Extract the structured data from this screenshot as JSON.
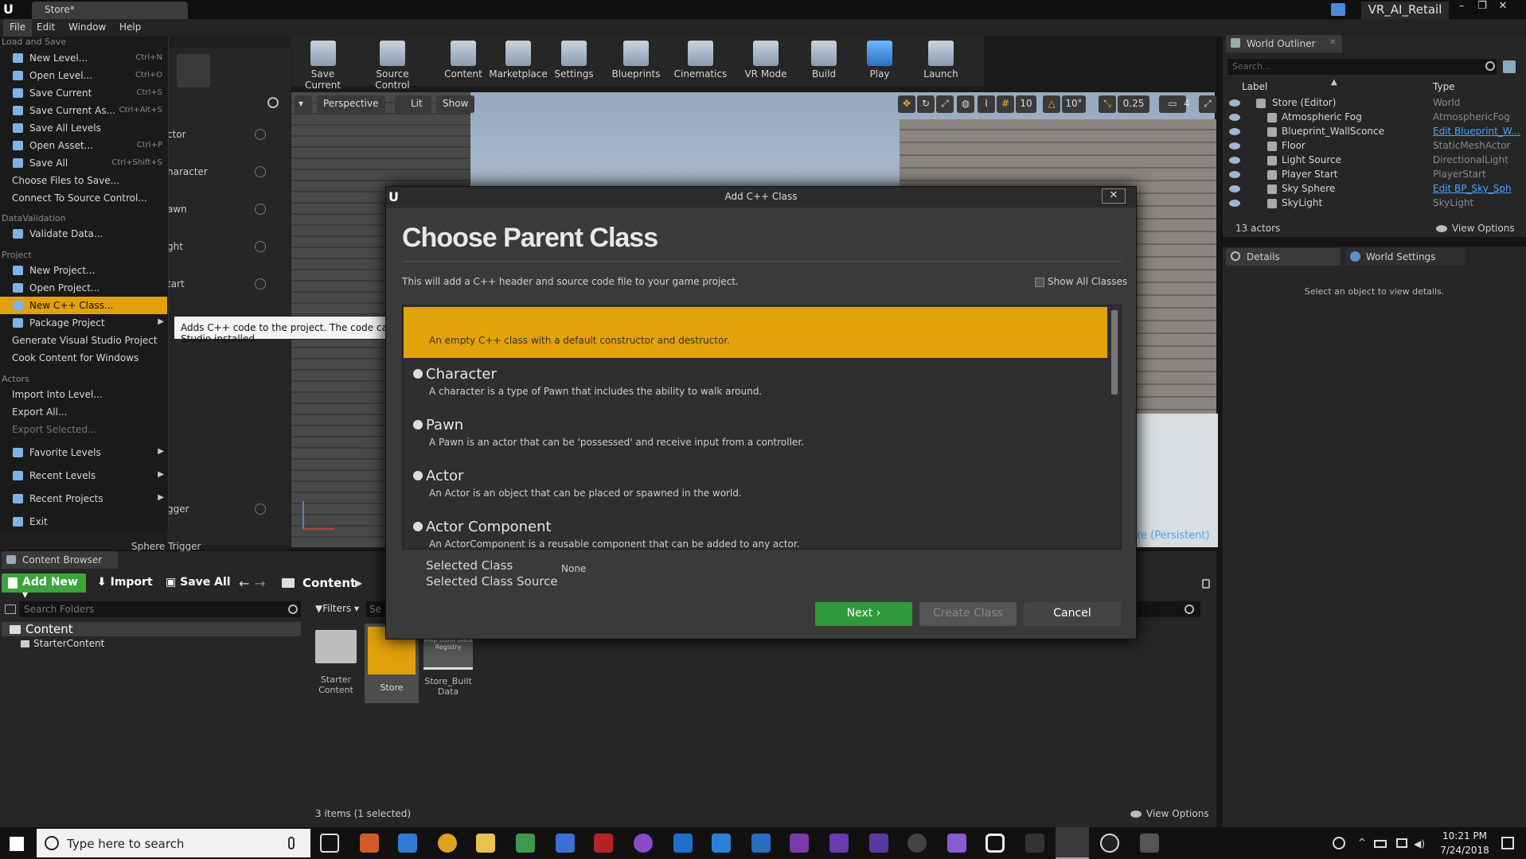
{
  "window": {
    "doc_tab": "Store*",
    "project": "VR_AI_Retail",
    "min": "–",
    "max": "❐",
    "close": "✕"
  },
  "menubar": [
    "File",
    "Edit",
    "Window",
    "Help"
  ],
  "toolbar": [
    "Save Current",
    "Source Control",
    "Content",
    "Marketplace",
    "Settings",
    "Blueprints",
    "Cinematics",
    "VR Mode",
    "Build",
    "Play",
    "Launch"
  ],
  "viewport": {
    "perspective": "Perspective",
    "lit": "Lit",
    "show": "Show",
    "grid": "10",
    "rot": "10°",
    "scale": "0.25",
    "cam": "4",
    "level": "ore (Persistent)"
  },
  "placelist": [
    "ctor",
    "haracter",
    "awn",
    "ght",
    "tart",
    "gger",
    "Sphere Trigger"
  ],
  "file_menu": {
    "sec_load": "Load and Save",
    "items_load": [
      {
        "label": "New Level...",
        "sc": "Ctrl+N"
      },
      {
        "label": "Open Level...",
        "sc": "Ctrl+O"
      },
      {
        "label": "Save Current",
        "sc": "Ctrl+S"
      },
      {
        "label": "Save Current As...",
        "sc": "Ctrl+Alt+S"
      },
      {
        "label": "Save All Levels",
        "sc": ""
      },
      {
        "label": "Open Asset...",
        "sc": "Ctrl+P"
      },
      {
        "label": "Save All",
        "sc": "Ctrl+Shift+S"
      },
      {
        "label": "Choose Files to Save...",
        "sc": ""
      },
      {
        "label": "Connect To Source Control...",
        "sc": ""
      }
    ],
    "sec_dv": "DataValidation",
    "validate": "Validate Data...",
    "sec_project": "Project",
    "items_project": [
      "New Project...",
      "Open Project...",
      "New C++ Class...",
      "Package Project",
      "Generate Visual Studio Project",
      "Cook Content for Windows"
    ],
    "sec_actors": "Actors",
    "items_actors": [
      "Import Into Level...",
      "Export All...",
      "Export Selected..."
    ],
    "favorite": "Favorite Levels",
    "recent_levels": "Recent Levels",
    "recent_projects": "Recent Projects",
    "exit": "Exit"
  },
  "tooltip": "Adds C++ code to the project. The code can only be compiled if you have Visual Studio installed.",
  "dialog": {
    "title": "Add C++ Class",
    "heading": "Choose Parent Class",
    "desc": "This will add a C++ header and source code file to your game project.",
    "show_all": "Show All Classes",
    "classes": [
      {
        "name": "",
        "desc": "An empty C++ class with a default constructor and destructor."
      },
      {
        "name": "Character",
        "desc": "A character is a type of Pawn that includes the ability to walk around."
      },
      {
        "name": "Pawn",
        "desc": "A Pawn is an actor that can be 'possessed' and receive input from a controller."
      },
      {
        "name": "Actor",
        "desc": "An Actor is an object that can be placed or spawned in the world."
      },
      {
        "name": "Actor Component",
        "desc": "An ActorComponent is a reusable component that can be added to any actor."
      }
    ],
    "selected_class_label": "Selected Class",
    "selected_class_value": "None",
    "selected_source_label": "Selected Class Source",
    "next": "Next ›",
    "create": "Create Class",
    "cancel": "Cancel"
  },
  "outliner": {
    "tab": "World Outliner",
    "search": "Search...",
    "col_label": "Label",
    "col_type": "Type",
    "rows": [
      {
        "label": "Store (Editor)",
        "type": "World",
        "link": false
      },
      {
        "label": "Atmospheric Fog",
        "type": "AtmosphericFog",
        "link": false
      },
      {
        "label": "Blueprint_WallSconce",
        "type": "Edit Blueprint_W...",
        "link": true
      },
      {
        "label": "Floor",
        "type": "StaticMeshActor",
        "link": false
      },
      {
        "label": "Light Source",
        "type": "DirectionalLight",
        "link": false
      },
      {
        "label": "Player Start",
        "type": "PlayerStart",
        "link": false
      },
      {
        "label": "Sky Sphere",
        "type": "Edit BP_Sky_Sph",
        "link": true
      },
      {
        "label": "SkyLight",
        "type": "SkyLight",
        "link": false
      }
    ],
    "count": "13 actors",
    "view_options": "View Options"
  },
  "details": {
    "tab": "Details",
    "tab2": "World Settings",
    "empty": "Select an object to view details."
  },
  "content_browser": {
    "tab": "Content Browser",
    "add_new": "Add New",
    "import": "Import",
    "save_all": "Save All",
    "path": "Content",
    "search_folders": "Search Folders",
    "filters": "Filters",
    "search_assets": "Se",
    "tree": [
      "Content",
      "StarterContent"
    ],
    "assets": [
      {
        "name": "Starter Content"
      },
      {
        "name": "Store"
      },
      {
        "name": "Store_Built Data",
        "thumb": "Map Build Data Registry"
      }
    ],
    "status": "3 items (1 selected)",
    "view_options": "View Options"
  },
  "taskbar": {
    "search": "Type here to search",
    "time": "10:21 PM",
    "date": "7/24/2018"
  }
}
